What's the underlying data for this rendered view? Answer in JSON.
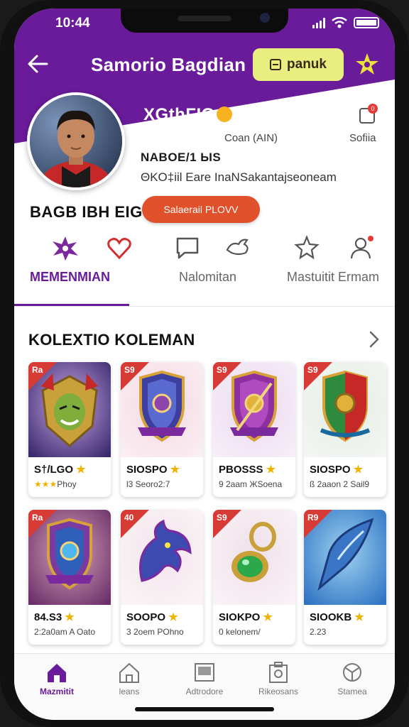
{
  "status": {
    "time": "10:44"
  },
  "header": {
    "title": "Samorio Bagdian",
    "pill_label": "panuk",
    "back_icon": "arrow-left-icon",
    "star_icon": "star-badge-icon"
  },
  "profile": {
    "handle": "XGthFIG",
    "stat_a": "Coan (AIN)",
    "stat_b": "Sofiia",
    "bio_title": "NABOE/1 ЫS",
    "bio_text": "ΘKO‡iil Eare InaNSakantajseoneam",
    "name": "BAGB IBH EIG",
    "action_label": "Salaerail PLOVV",
    "notif_count": "0"
  },
  "tabs": [
    {
      "label": "MEMENMIAN",
      "icon": "star-heart-icon",
      "active": true
    },
    {
      "label": "Nalomitan",
      "icon": "chat-icon",
      "active": false
    },
    {
      "label": "Mastuitit Ermam",
      "icon": "user-icon",
      "active": false
    }
  ],
  "collection": {
    "title": "KOLEXTIO KOLEMAN",
    "cards": [
      {
        "rank": "Ra",
        "name": "S†/LGO",
        "sub": "Phoy",
        "stars": "★★★",
        "art": "warrior",
        "bg1": "#3b2a6e",
        "bg2": "#c9a8e6"
      },
      {
        "rank": "S9",
        "name": "SIOSPO",
        "sub": "l3 Seoro2:7",
        "stars": "",
        "art": "shield-drop",
        "bg1": "#fbeef2",
        "bg2": "#f3d8e3"
      },
      {
        "rank": "S9",
        "name": "PBOSSS",
        "sub": "9 2aam ЖSoena",
        "stars": "",
        "art": "shield-sword",
        "bg1": "#f6eef8",
        "bg2": "#ecd9ef"
      },
      {
        "rank": "S9",
        "name": "SIOSPO",
        "sub": "ß 2aaon 2 Sail9",
        "stars": "",
        "art": "shield-green",
        "bg1": "#f3f6f3",
        "bg2": "#e3ece3"
      },
      {
        "rank": "Ra",
        "name": "84.S3",
        "sub": "2:2a0am A Oato",
        "stars": "",
        "art": "shield-blue",
        "bg1": "#6a2f6a",
        "bg2": "#d9a3b8"
      },
      {
        "rank": "40",
        "name": "SOOPO",
        "sub": "3 2oem POhno",
        "stars": "",
        "art": "dragon",
        "bg1": "#fbf4f6",
        "bg2": "#f1e4ec"
      },
      {
        "rank": "S9",
        "name": "SIOKPO",
        "sub": "0 kelonem/",
        "stars": "",
        "art": "amulet",
        "bg1": "#f9f2f6",
        "bg2": "#efe1ea"
      },
      {
        "rank": "R9",
        "name": "SIOOKB",
        "sub": "2.23",
        "stars": "",
        "art": "blade",
        "bg1": "#2f74c4",
        "bg2": "#9fd2f0"
      }
    ]
  },
  "bottom_nav": [
    {
      "label": "Mazmitit",
      "icon": "home-icon",
      "active": true
    },
    {
      "label": "leans",
      "icon": "house-outline-icon",
      "active": false
    },
    {
      "label": "Adtrodore",
      "icon": "gallery-icon",
      "active": false
    },
    {
      "label": "Rikeosans",
      "icon": "camera-box-icon",
      "active": false
    },
    {
      "label": "Stamea",
      "icon": "globe-icon",
      "active": false
    }
  ],
  "colors": {
    "brand": "#6a1b9a",
    "accent_yellow": "#e8ee7f",
    "action_orange": "#e0502a",
    "rank_red": "#d63b35"
  }
}
